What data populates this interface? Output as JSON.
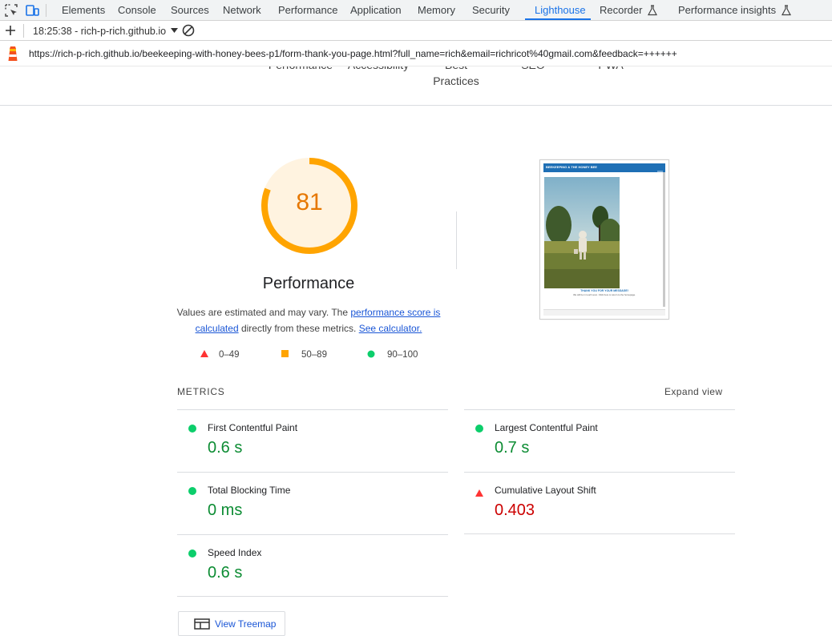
{
  "devtools": {
    "tabs": [
      "Elements",
      "Console",
      "Sources",
      "Network",
      "Performance",
      "Application",
      "Memory",
      "Security",
      "Lighthouse",
      "Recorder",
      "Performance insights"
    ],
    "active_tab": "Lighthouse",
    "inspect_icon": "inspect-element-icon",
    "device_icon": "device-toolbar-icon",
    "flask_icon": "experiment-flask-icon"
  },
  "toolbar": {
    "report_selector": "18:25:38 - rich-p-rich.github.io",
    "add_icon": "plus-icon",
    "clear_icon": "clear-circle-icon"
  },
  "url": "https://rich-p-rich.github.io/beekeeping-with-honey-bees-p1/form-thank-you-page.html?full_name=rich&email=richricot%40gmail.com&feedback=++++++",
  "categories": {
    "performance": "Performance",
    "accessibility": "Accessibility",
    "best_practices_1": "Best",
    "best_practices_2": "Practices",
    "seo": "SEO",
    "pwa": "PWA"
  },
  "gauge": {
    "score": "81",
    "score_fraction": 0.81,
    "title": "Performance",
    "color": "#ffa400",
    "fill": "#fff3e0"
  },
  "description": {
    "text1": "Values are estimated and may vary. The",
    "link1": "performance score is calculated",
    "text2": "directly from these metrics.",
    "link2": "See calculator."
  },
  "legend": [
    {
      "label": "0–49",
      "shape": "triangle",
      "color": "#ff3333"
    },
    {
      "label": "50–89",
      "shape": "square",
      "color": "#ffa400"
    },
    {
      "label": "90–100",
      "shape": "circle",
      "color": "#0cce6b"
    }
  ],
  "screenshot": {
    "site_title": "BEEKEEPING & THE HONEY BEE",
    "message": "THANK YOU FOR YOUR MESSAGE!",
    "sub": "We will be in touch soon. Click here to return to the homepage."
  },
  "metrics": {
    "header": "METRICS",
    "expand": "Expand view",
    "items": [
      {
        "name": "First Contentful Paint",
        "value": "0.6 s",
        "status": "pass"
      },
      {
        "name": "Largest Contentful Paint",
        "value": "0.7 s",
        "status": "pass"
      },
      {
        "name": "Total Blocking Time",
        "value": "0 ms",
        "status": "pass"
      },
      {
        "name": "Cumulative Layout Shift",
        "value": "0.403",
        "status": "fail"
      },
      {
        "name": "Speed Index",
        "value": "0.6 s",
        "status": "pass"
      }
    ]
  },
  "treemap_button": "View Treemap"
}
